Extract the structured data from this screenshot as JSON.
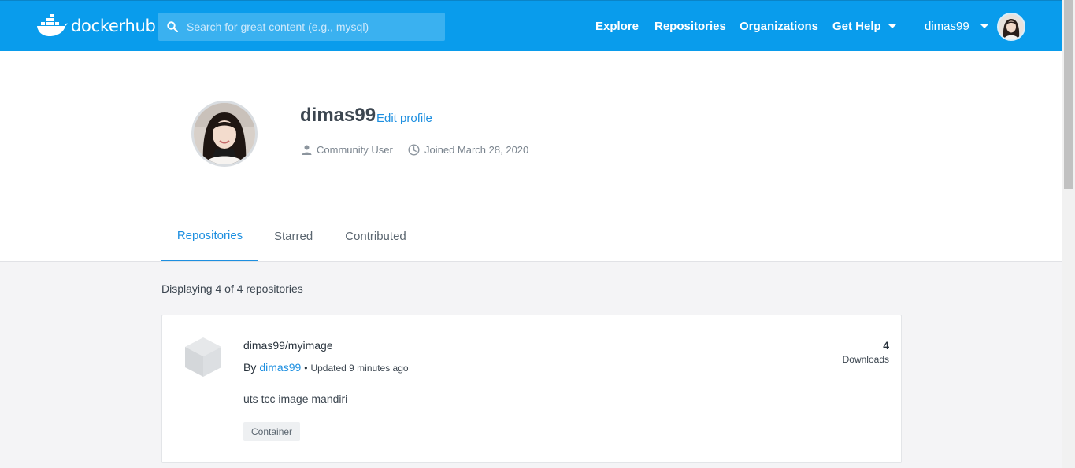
{
  "header": {
    "logo_docker": "docker",
    "logo_hub": "hub",
    "search_placeholder": "Search for great content (e.g., mysql)",
    "nav": {
      "explore": "Explore",
      "repositories": "Repositories",
      "organizations": "Organizations",
      "get_help": "Get Help",
      "username": "dimas99"
    },
    "brand_color": "#099cec"
  },
  "profile": {
    "username": "dimas99",
    "edit_profile": "Edit profile",
    "role": "Community User",
    "joined": "Joined March 28, 2020"
  },
  "tabs": [
    {
      "label": "Repositories",
      "active": true
    },
    {
      "label": "Starred",
      "active": false
    },
    {
      "label": "Contributed",
      "active": false
    }
  ],
  "main": {
    "count_text": "Displaying 4 of 4 repositories",
    "repos": [
      {
        "name": "dimas99/myimage",
        "by_label": "By",
        "owner": "dimas99",
        "separator": "•",
        "updated": "Updated 9 minutes ago",
        "description": "uts tcc image mandiri",
        "tag": "Container",
        "downloads": "4",
        "downloads_label": "Downloads"
      }
    ]
  },
  "icons": {
    "logo": "docker-whale-icon",
    "search": "search-icon",
    "user": "user-icon",
    "clock": "clock-icon",
    "repo": "cube-icon",
    "caret": "caret-down-icon"
  }
}
